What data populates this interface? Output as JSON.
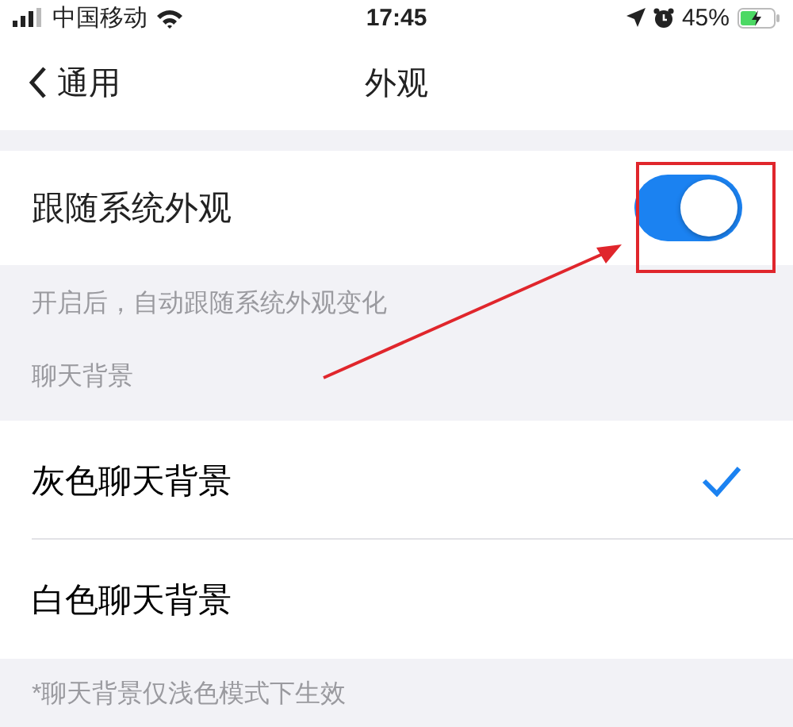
{
  "status_bar": {
    "carrier": "中国移动",
    "time": "17:45",
    "battery": "45%"
  },
  "nav": {
    "back": "通用",
    "title": "外观"
  },
  "follow_system": {
    "label": "跟随系统外观",
    "on": true,
    "hint": "开启后，自动跟随系统外观变化"
  },
  "chat_background": {
    "header": "聊天背景",
    "options": [
      {
        "label": "灰色聊天背景",
        "selected": true
      },
      {
        "label": "白色聊天背景",
        "selected": false
      }
    ],
    "note": "*聊天背景仅浅色模式下生效"
  }
}
